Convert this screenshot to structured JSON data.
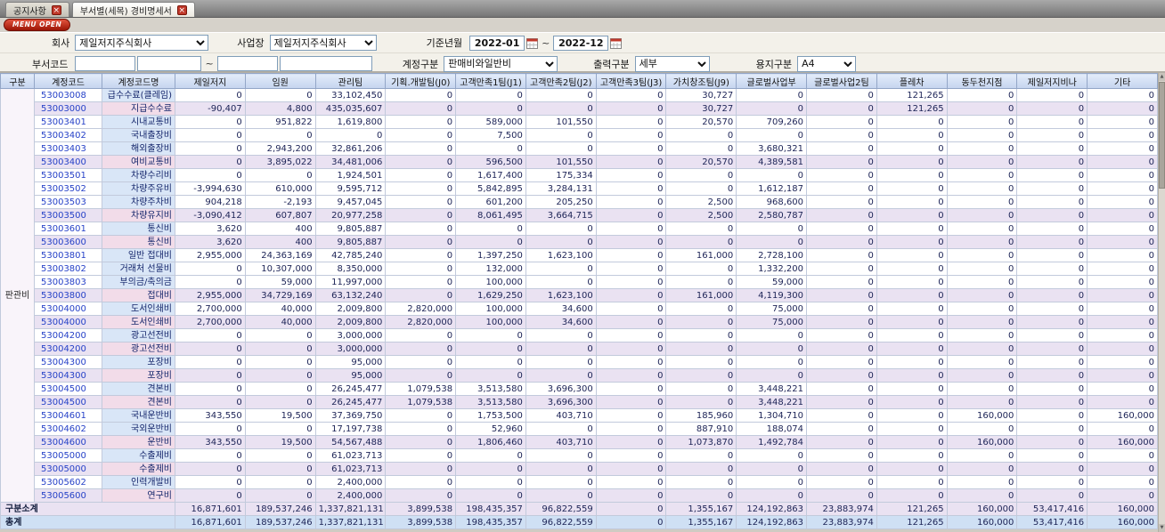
{
  "colors": {
    "accent_red": "#c0392b",
    "header_bg": "#c5d4ee",
    "header_bg_top": "#e3ecfa",
    "subtotal_bg": "#eae2f2",
    "total_row_bg": "#cfe0f4",
    "name_cell_bg": "#d9e6f7",
    "name_cell_subtotal_bg": "#f2dce9",
    "code_text": "#2742c8"
  },
  "tabs": [
    {
      "label": "공지사항"
    },
    {
      "label": "부서별(세목) 경비명세서"
    }
  ],
  "menu_open_label": "MENU OPEN",
  "filters": {
    "company_label": "회사",
    "company_value": "제일저지주식회사",
    "site_label": "사업장",
    "site_value": "제일저지주식회사",
    "period_label": "기준년월",
    "period_from": "2022-01",
    "period_to": "2022-12",
    "tilde": "~",
    "dept_label": "부서코드",
    "dept_from_code": "",
    "dept_from_name": "",
    "dept_to_code": "",
    "dept_to_name": "",
    "account_label": "계정구분",
    "account_value": "판매비와일반비",
    "output_label": "출력구분",
    "output_value": "세부",
    "paper_label": "용지구분",
    "paper_value": "A4"
  },
  "table": {
    "group_label": "판관비",
    "columns": [
      "구분",
      "계정코드",
      "계정코드명",
      "제일저지",
      "임원",
      "관리팀",
      "기획.개발팀(J0)",
      "고객만족1팀(J1)",
      "고객만족2팀(J2)",
      "고객만족3팀(J3)",
      "가치창조팀(J9)",
      "글로벌사업부",
      "글로벌사업2팀",
      "플레차",
      "동두천지점",
      "제일저지비나",
      "기타"
    ],
    "rows": [
      {
        "code": "53003008",
        "name": "급수수료(클레임)",
        "kind": "detail",
        "values": [
          "0",
          "0",
          "33,102,450",
          "0",
          "0",
          "0",
          "0",
          "30,727",
          "0",
          "0",
          "121,265",
          "0",
          "0",
          "0"
        ]
      },
      {
        "code": "53003000",
        "name": "지급수수료",
        "kind": "subtotal",
        "values": [
          "-90,407",
          "4,800",
          "435,035,607",
          "0",
          "0",
          "0",
          "0",
          "30,727",
          "0",
          "0",
          "121,265",
          "0",
          "0",
          "0"
        ]
      },
      {
        "code": "53003401",
        "name": "시내교통비",
        "kind": "detail",
        "values": [
          "0",
          "951,822",
          "1,619,800",
          "0",
          "589,000",
          "101,550",
          "0",
          "20,570",
          "709,260",
          "0",
          "0",
          "0",
          "0",
          "0"
        ]
      },
      {
        "code": "53003402",
        "name": "국내출장비",
        "kind": "detail",
        "values": [
          "0",
          "0",
          "0",
          "0",
          "7,500",
          "0",
          "0",
          "0",
          "0",
          "0",
          "0",
          "0",
          "0",
          "0"
        ]
      },
      {
        "code": "53003403",
        "name": "해외출장비",
        "kind": "detail",
        "values": [
          "0",
          "2,943,200",
          "32,861,206",
          "0",
          "0",
          "0",
          "0",
          "0",
          "3,680,321",
          "0",
          "0",
          "0",
          "0",
          "0"
        ]
      },
      {
        "code": "53003400",
        "name": "여비교통비",
        "kind": "subtotal",
        "values": [
          "0",
          "3,895,022",
          "34,481,006",
          "0",
          "596,500",
          "101,550",
          "0",
          "20,570",
          "4,389,581",
          "0",
          "0",
          "0",
          "0",
          "0"
        ]
      },
      {
        "code": "53003501",
        "name": "차량수리비",
        "kind": "detail",
        "values": [
          "0",
          "0",
          "1,924,501",
          "0",
          "1,617,400",
          "175,334",
          "0",
          "0",
          "0",
          "0",
          "0",
          "0",
          "0",
          "0"
        ]
      },
      {
        "code": "53003502",
        "name": "차량주유비",
        "kind": "detail",
        "values": [
          "-3,994,630",
          "610,000",
          "9,595,712",
          "0",
          "5,842,895",
          "3,284,131",
          "0",
          "0",
          "1,612,187",
          "0",
          "0",
          "0",
          "0",
          "0"
        ]
      },
      {
        "code": "53003503",
        "name": "차량주차비",
        "kind": "detail",
        "values": [
          "904,218",
          "-2,193",
          "9,457,045",
          "0",
          "601,200",
          "205,250",
          "0",
          "2,500",
          "968,600",
          "0",
          "0",
          "0",
          "0",
          "0"
        ]
      },
      {
        "code": "53003500",
        "name": "차량유지비",
        "kind": "subtotal",
        "values": [
          "-3,090,412",
          "607,807",
          "20,977,258",
          "0",
          "8,061,495",
          "3,664,715",
          "0",
          "2,500",
          "2,580,787",
          "0",
          "0",
          "0",
          "0",
          "0"
        ]
      },
      {
        "code": "53003601",
        "name": "통신비",
        "kind": "detail",
        "values": [
          "3,620",
          "400",
          "9,805,887",
          "0",
          "0",
          "0",
          "0",
          "0",
          "0",
          "0",
          "0",
          "0",
          "0",
          "0"
        ]
      },
      {
        "code": "53003600",
        "name": "통신비",
        "kind": "subtotal",
        "values": [
          "3,620",
          "400",
          "9,805,887",
          "0",
          "0",
          "0",
          "0",
          "0",
          "0",
          "0",
          "0",
          "0",
          "0",
          "0"
        ]
      },
      {
        "code": "53003801",
        "name": "일반 접대비",
        "kind": "detail",
        "values": [
          "2,955,000",
          "24,363,169",
          "42,785,240",
          "0",
          "1,397,250",
          "1,623,100",
          "0",
          "161,000",
          "2,728,100",
          "0",
          "0",
          "0",
          "0",
          "0"
        ]
      },
      {
        "code": "53003802",
        "name": "거래처 선물비",
        "kind": "detail",
        "values": [
          "0",
          "10,307,000",
          "8,350,000",
          "0",
          "132,000",
          "0",
          "0",
          "0",
          "1,332,200",
          "0",
          "0",
          "0",
          "0",
          "0"
        ]
      },
      {
        "code": "53003803",
        "name": "부의금/축의금",
        "kind": "detail",
        "values": [
          "0",
          "59,000",
          "11,997,000",
          "0",
          "100,000",
          "0",
          "0",
          "0",
          "59,000",
          "0",
          "0",
          "0",
          "0",
          "0"
        ]
      },
      {
        "code": "53003800",
        "name": "접대비",
        "kind": "subtotal",
        "values": [
          "2,955,000",
          "34,729,169",
          "63,132,240",
          "0",
          "1,629,250",
          "1,623,100",
          "0",
          "161,000",
          "4,119,300",
          "0",
          "0",
          "0",
          "0",
          "0"
        ]
      },
      {
        "code": "53004000",
        "name": "도서인쇄비",
        "kind": "detail",
        "values": [
          "2,700,000",
          "40,000",
          "2,009,800",
          "2,820,000",
          "100,000",
          "34,600",
          "0",
          "0",
          "75,000",
          "0",
          "0",
          "0",
          "0",
          "0"
        ]
      },
      {
        "code": "53004000",
        "name": "도서인쇄비",
        "kind": "subtotal",
        "values": [
          "2,700,000",
          "40,000",
          "2,009,800",
          "2,820,000",
          "100,000",
          "34,600",
          "0",
          "0",
          "75,000",
          "0",
          "0",
          "0",
          "0",
          "0"
        ]
      },
      {
        "code": "53004200",
        "name": "광고선전비",
        "kind": "detail",
        "values": [
          "0",
          "0",
          "3,000,000",
          "0",
          "0",
          "0",
          "0",
          "0",
          "0",
          "0",
          "0",
          "0",
          "0",
          "0"
        ]
      },
      {
        "code": "53004200",
        "name": "광고선전비",
        "kind": "subtotal",
        "values": [
          "0",
          "0",
          "3,000,000",
          "0",
          "0",
          "0",
          "0",
          "0",
          "0",
          "0",
          "0",
          "0",
          "0",
          "0"
        ]
      },
      {
        "code": "53004300",
        "name": "포장비",
        "kind": "detail",
        "values": [
          "0",
          "0",
          "95,000",
          "0",
          "0",
          "0",
          "0",
          "0",
          "0",
          "0",
          "0",
          "0",
          "0",
          "0"
        ]
      },
      {
        "code": "53004300",
        "name": "포장비",
        "kind": "subtotal",
        "values": [
          "0",
          "0",
          "95,000",
          "0",
          "0",
          "0",
          "0",
          "0",
          "0",
          "0",
          "0",
          "0",
          "0",
          "0"
        ]
      },
      {
        "code": "53004500",
        "name": "견본비",
        "kind": "detail",
        "values": [
          "0",
          "0",
          "26,245,477",
          "1,079,538",
          "3,513,580",
          "3,696,300",
          "0",
          "0",
          "3,448,221",
          "0",
          "0",
          "0",
          "0",
          "0"
        ]
      },
      {
        "code": "53004500",
        "name": "견본비",
        "kind": "subtotal",
        "values": [
          "0",
          "0",
          "26,245,477",
          "1,079,538",
          "3,513,580",
          "3,696,300",
          "0",
          "0",
          "3,448,221",
          "0",
          "0",
          "0",
          "0",
          "0"
        ]
      },
      {
        "code": "53004601",
        "name": "국내운반비",
        "kind": "detail",
        "values": [
          "343,550",
          "19,500",
          "37,369,750",
          "0",
          "1,753,500",
          "403,710",
          "0",
          "185,960",
          "1,304,710",
          "0",
          "0",
          "160,000",
          "0",
          "160,000"
        ]
      },
      {
        "code": "53004602",
        "name": "국외운반비",
        "kind": "detail",
        "values": [
          "0",
          "0",
          "17,197,738",
          "0",
          "52,960",
          "0",
          "0",
          "887,910",
          "188,074",
          "0",
          "0",
          "0",
          "0",
          "0"
        ]
      },
      {
        "code": "53004600",
        "name": "운반비",
        "kind": "subtotal",
        "values": [
          "343,550",
          "19,500",
          "54,567,488",
          "0",
          "1,806,460",
          "403,710",
          "0",
          "1,073,870",
          "1,492,784",
          "0",
          "0",
          "160,000",
          "0",
          "160,000"
        ]
      },
      {
        "code": "53005000",
        "name": "수출제비",
        "kind": "detail",
        "values": [
          "0",
          "0",
          "61,023,713",
          "0",
          "0",
          "0",
          "0",
          "0",
          "0",
          "0",
          "0",
          "0",
          "0",
          "0"
        ]
      },
      {
        "code": "53005000",
        "name": "수출제비",
        "kind": "subtotal",
        "values": [
          "0",
          "0",
          "61,023,713",
          "0",
          "0",
          "0",
          "0",
          "0",
          "0",
          "0",
          "0",
          "0",
          "0",
          "0"
        ]
      },
      {
        "code": "53005602",
        "name": "인력개발비",
        "kind": "detail",
        "values": [
          "0",
          "0",
          "2,400,000",
          "0",
          "0",
          "0",
          "0",
          "0",
          "0",
          "0",
          "0",
          "0",
          "0",
          "0"
        ]
      },
      {
        "code": "53005600",
        "name": "연구비",
        "kind": "subtotal",
        "values": [
          "0",
          "0",
          "2,400,000",
          "0",
          "0",
          "0",
          "0",
          "0",
          "0",
          "0",
          "0",
          "0",
          "0",
          "0"
        ]
      }
    ],
    "footer": [
      {
        "label": "구분소계",
        "kind": "frow-sub",
        "values": [
          "16,871,601",
          "189,537,246",
          "1,337,821,131",
          "3,899,538",
          "198,435,357",
          "96,822,559",
          "0",
          "1,355,167",
          "124,192,863",
          "23,883,974",
          "121,265",
          "160,000",
          "53,417,416",
          "160,000"
        ]
      },
      {
        "label": "총계",
        "kind": "frow-total",
        "values": [
          "16,871,601",
          "189,537,246",
          "1,337,821,131",
          "3,899,538",
          "198,435,357",
          "96,822,559",
          "0",
          "1,355,167",
          "124,192,863",
          "23,883,974",
          "121,265",
          "160,000",
          "53,417,416",
          "160,000"
        ]
      }
    ]
  }
}
